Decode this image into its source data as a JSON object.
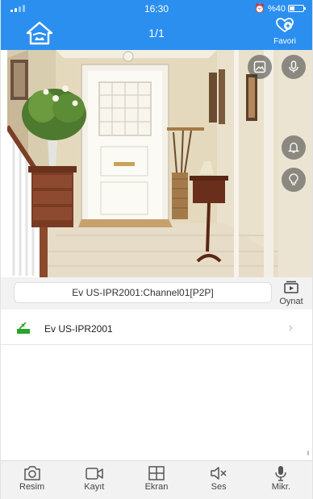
{
  "status_bar": {
    "time": "16:30",
    "battery": "%40"
  },
  "header": {
    "page_counter": "1/1",
    "favorite_label": "Favori"
  },
  "camera_view": {
    "overlay_buttons": [
      "snapshot-icon",
      "microphone-icon",
      "alarm-bell-icon",
      "light-bulb-icon"
    ]
  },
  "channel": {
    "name": "Ev US-IPR2001:Channel01[P2P]",
    "play_label": "Oynat"
  },
  "devices": [
    {
      "label": "Ev US-IPR2001"
    }
  ],
  "toolbar": {
    "items": [
      {
        "label": "Resim",
        "icon": "camera-icon"
      },
      {
        "label": "Kayıt",
        "icon": "video-record-icon"
      },
      {
        "label": "Ekran",
        "icon": "grid-screen-icon"
      },
      {
        "label": "Ses",
        "icon": "speaker-mute-icon"
      },
      {
        "label": "Mikr.",
        "icon": "microphone-icon"
      }
    ]
  },
  "colors": {
    "header": "#2b8ff0",
    "toolbar_bg": "#f2f2f2",
    "device_icon": "#2aa52a"
  }
}
